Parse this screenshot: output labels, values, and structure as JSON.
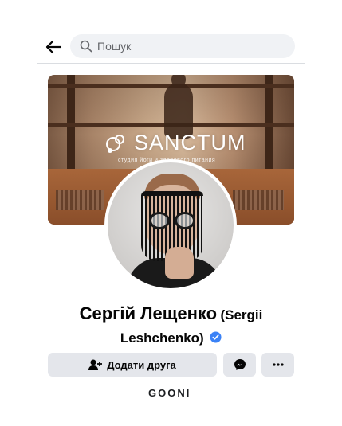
{
  "header": {
    "back_icon": "arrow-left-icon",
    "search_icon": "search-icon",
    "search_placeholder": "Пошук"
  },
  "cover": {
    "brand_name": "SANCTUM",
    "brand_tagline": "студия йоги и здорового питания",
    "brand_logo_icon": "sanctum-logo-icon"
  },
  "profile": {
    "name": "Сергій Лещенко",
    "alternate_name": "(Sergii Leshchenko)",
    "verified_icon": "verified-badge-icon",
    "verified_color": "#3b82f6"
  },
  "actions": {
    "add_friend_label": "Додати друга",
    "add_friend_icon": "add-friend-icon",
    "messenger_icon": "messenger-icon",
    "more_icon": "more-dots-icon"
  },
  "watermark": "GOONI",
  "colors": {
    "button_bg": "#e4e6eb",
    "search_bg": "#f0f2f5",
    "text_primary": "#050505",
    "text_secondary": "#65676b"
  }
}
